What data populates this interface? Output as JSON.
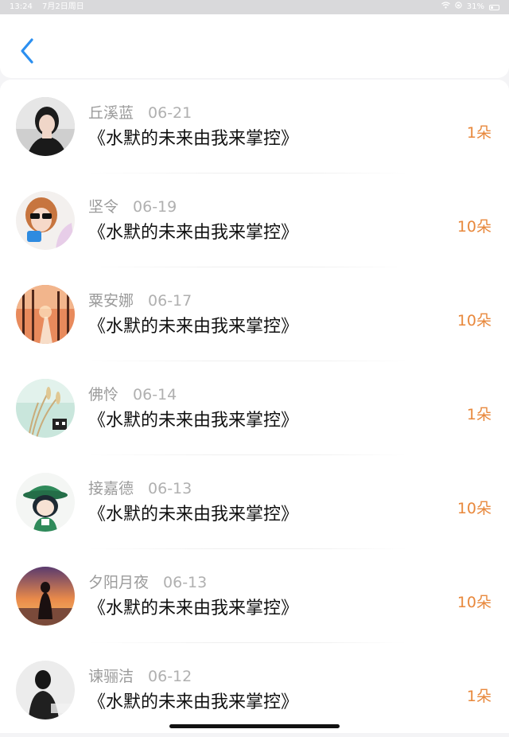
{
  "status_bar": {
    "time": "13:24",
    "date": "7月2日周日",
    "battery": "31%"
  },
  "header": {
    "back_icon": "chevron-left-icon",
    "accent_color": "#2b8ff0"
  },
  "gift_list": {
    "count_color": "#e8883c",
    "rows": [
      {
        "name": "丘溪蓝",
        "date": "06-21",
        "title": "《水默的未来由我来掌控》",
        "count": "1朵",
        "avatar": "avatar-portrait-girl"
      },
      {
        "name": "坚令",
        "date": "06-19",
        "title": "《水默的未来由我来掌控》",
        "count": "10朵",
        "avatar": "avatar-sunglasses-girl"
      },
      {
        "name": "粟安娜",
        "date": "06-17",
        "title": "《水默的未来由我来掌控》",
        "count": "10朵",
        "avatar": "avatar-autumn-forest"
      },
      {
        "name": "佛怜",
        "date": "06-14",
        "title": "《水默的未来由我来掌控》",
        "count": "1朵",
        "avatar": "avatar-wheat-stalks"
      },
      {
        "name": "接嘉德",
        "date": "06-13",
        "title": "《水默的未来由我来掌控》",
        "count": "10朵",
        "avatar": "avatar-anime-green-hat"
      },
      {
        "name": "夕阳月夜",
        "date": "06-13",
        "title": "《水默的未来由我来掌控》",
        "count": "10朵",
        "avatar": "avatar-sunset-silhouette"
      },
      {
        "name": "谏骊洁",
        "date": "06-12",
        "title": "《水默的未来由我来掌控》",
        "count": "1朵",
        "avatar": "avatar-monochrome-figure"
      }
    ]
  }
}
